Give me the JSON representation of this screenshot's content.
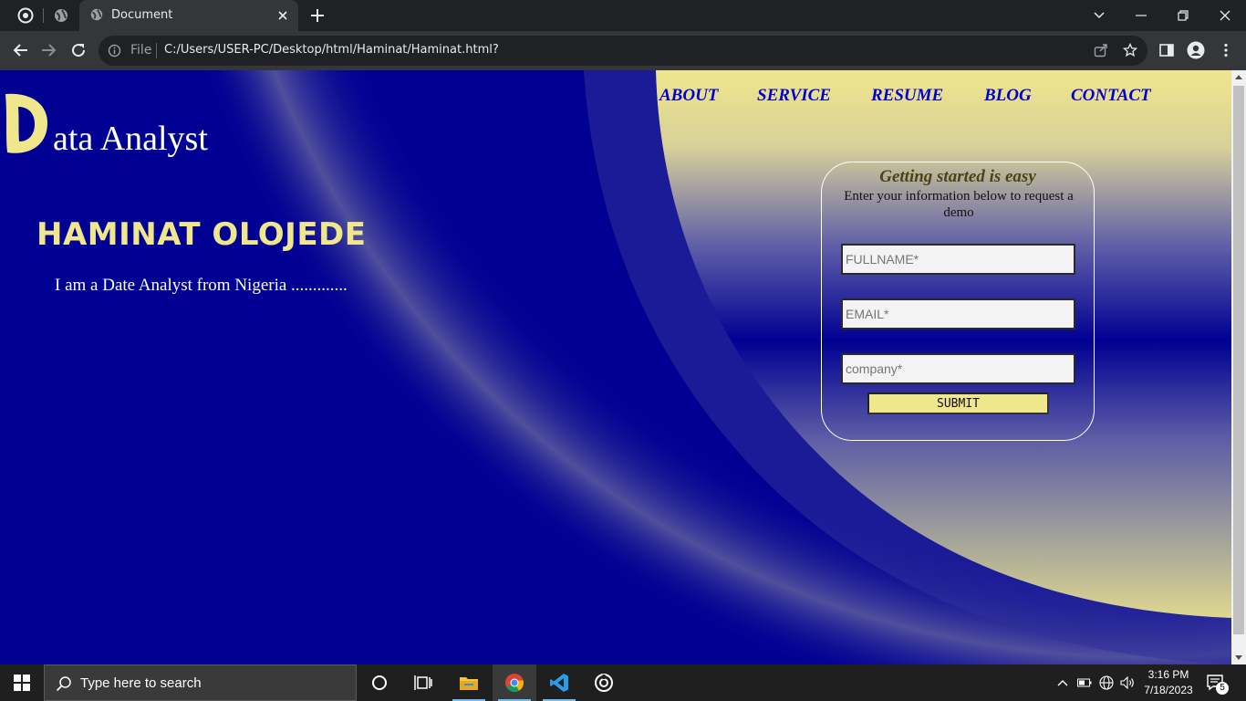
{
  "browser": {
    "tab_title": "Document",
    "url_scheme_label": "File",
    "url": "C:/Users/USER-PC/Desktop/html/Haminat/Haminat.html?"
  },
  "page": {
    "logo_letter": "D",
    "logo_text": "ata Analyst",
    "nav": [
      {
        "label": "ABOUT"
      },
      {
        "label": "SERVICE"
      },
      {
        "label": "RESUME"
      },
      {
        "label": "BLOG"
      },
      {
        "label": "CONTACT"
      }
    ],
    "hero_name": "HAMINAT OLOJEDE",
    "hero_tagline": "I am a Date Analyst from Nigeria .............",
    "form": {
      "heading": "Getting started is easy",
      "subheading": "Enter your information below to request a demo",
      "fullname_placeholder": "FULLNAME*",
      "email_placeholder": "EMAIL*",
      "company_placeholder": "company*",
      "submit_label": "SUBMIT"
    },
    "colors": {
      "background": "#000093",
      "accent": "#f0e68c",
      "nav_link": "#0000d0"
    }
  },
  "taskbar": {
    "search_placeholder": "Type here to search",
    "time": "3:16 PM",
    "date": "7/18/2023",
    "notification_count": "5"
  }
}
